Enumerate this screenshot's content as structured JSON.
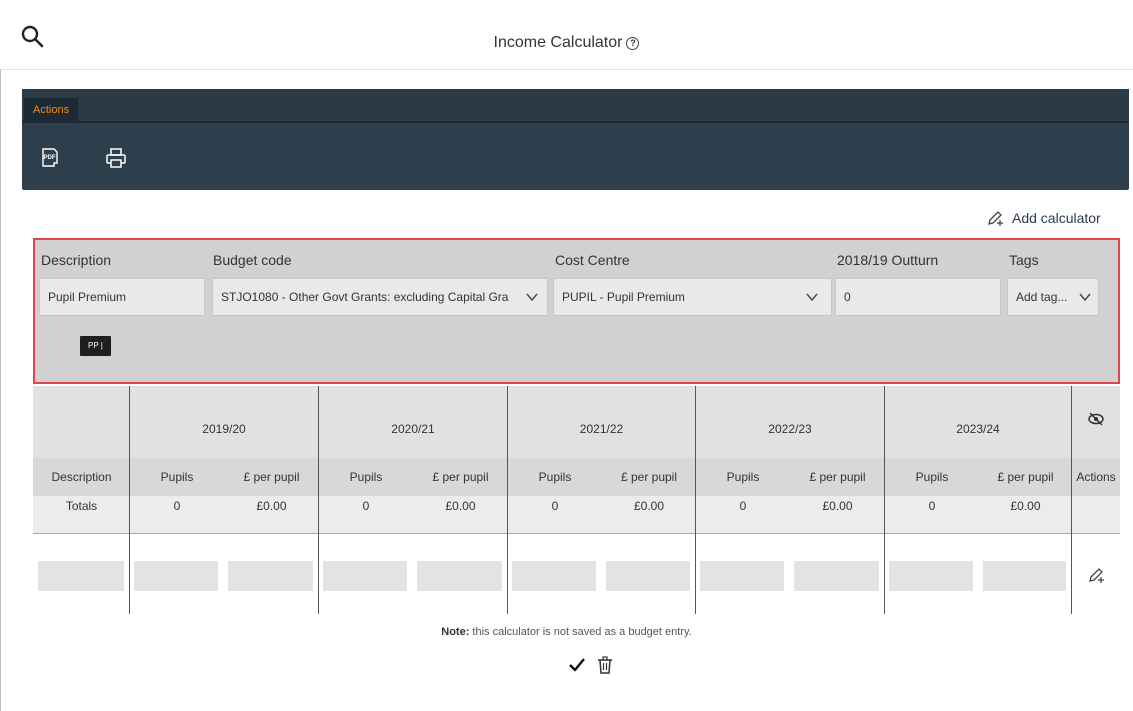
{
  "header": {
    "title": "Income Calculator",
    "help_glyph": "?",
    "search_icon": "search-icon",
    "help_icon": "help-circle-icon"
  },
  "actions": {
    "tab_label": "Actions",
    "tools": [
      {
        "name": "pdf-export-icon",
        "glyph": "PDF"
      },
      {
        "name": "print-icon"
      }
    ]
  },
  "add_calculator": {
    "label": "Add calculator",
    "icon": "edit-pencil-icon"
  },
  "form": {
    "description": {
      "label": "Description",
      "value": "Pupil Premium"
    },
    "budget_code": {
      "label": "Budget code",
      "value": "STJO1080 - Other Govt Grants: excluding Capital Gra"
    },
    "cost_centre": {
      "label": "Cost Centre",
      "value": "PUPIL - Pupil Premium"
    },
    "outturn": {
      "label": "2018/19 Outturn",
      "value": "0"
    },
    "tags": {
      "label": "Tags",
      "placeholder": "Add tag..."
    },
    "chip": "PP |"
  },
  "table": {
    "years": [
      "2019/20",
      "2020/21",
      "2021/22",
      "2022/23",
      "2023/24"
    ],
    "col_description": "Description",
    "col_pupils": "Pupils",
    "col_per_pupil": "£ per pupil",
    "col_actions": "Actions",
    "totals_label": "Totals",
    "totals": [
      {
        "pupils": "0",
        "per_pupil": "£0.00"
      },
      {
        "pupils": "0",
        "per_pupil": "£0.00"
      },
      {
        "pupils": "0",
        "per_pupil": "£0.00"
      },
      {
        "pupils": "0",
        "per_pupil": "£0.00"
      },
      {
        "pupils": "0",
        "per_pupil": "£0.00"
      }
    ]
  },
  "note": {
    "bold": "Note:",
    "text": " this calculator is not saved as a budget entry."
  },
  "colors": {
    "panel": "#2d3e4d",
    "tab_text": "#f08a24",
    "highlight_border": "#e04848",
    "form_bg": "#d1d1d1"
  }
}
